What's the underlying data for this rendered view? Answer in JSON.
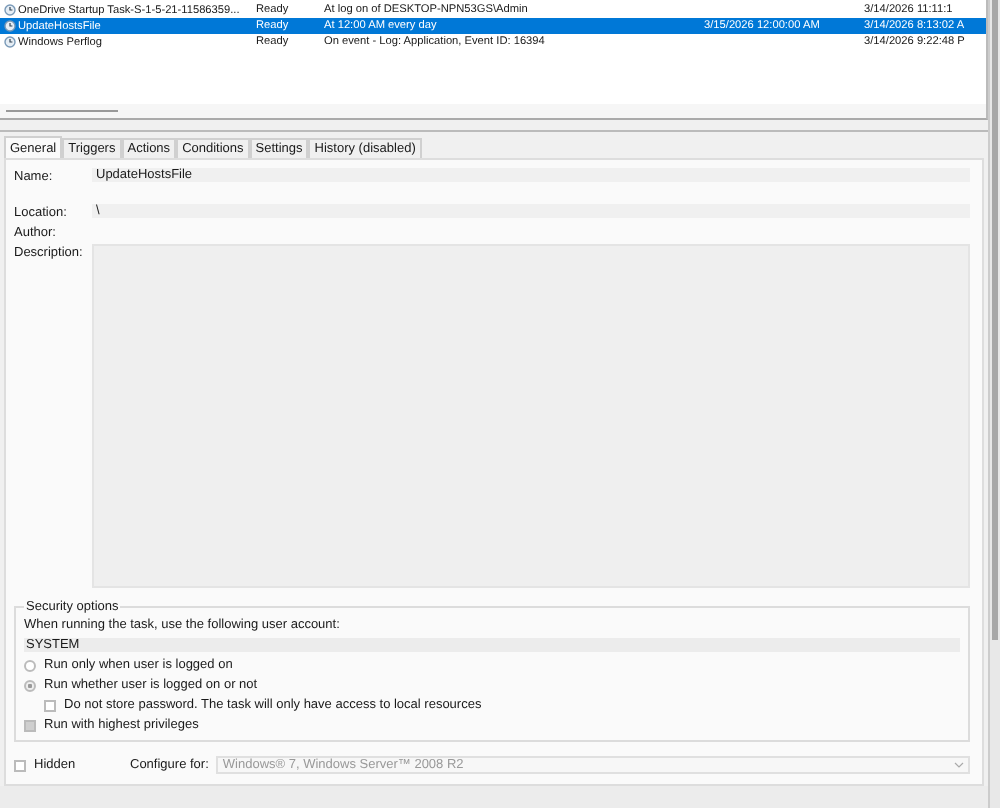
{
  "tasks": [
    {
      "name": "OneDrive Startup Task-S-1-5-21-11586359...",
      "status": "Ready",
      "triggers": "At log on of DESKTOP-NPN53GS\\Admin",
      "last_run": "3/14/2026 11:11:1",
      "selected": false
    },
    {
      "name": "UpdateHostsFile",
      "status": "Ready",
      "triggers": "At 12:00 AM every day",
      "next_run": "3/15/2026 12:00:00 AM",
      "last_run": "3/14/2026 8:13:02 A",
      "selected": true
    },
    {
      "name": "Windows Perflog",
      "status": "Ready",
      "triggers": "On event - Log: Application, Event ID: 16394",
      "last_run": "3/14/2026 9:22:48 P",
      "selected": false
    }
  ],
  "tabs": [
    {
      "label": "General",
      "selected": true
    },
    {
      "label": "Triggers",
      "selected": false
    },
    {
      "label": "Actions",
      "selected": false
    },
    {
      "label": "Conditions",
      "selected": false
    },
    {
      "label": "Settings",
      "selected": false
    },
    {
      "label": "History (disabled)",
      "selected": false
    }
  ],
  "general": {
    "name_label": "Name:",
    "name": "UpdateHostsFile",
    "location_label": "Location:",
    "location": "\\",
    "author_label": "Author:",
    "description_label": "Description:"
  },
  "security": {
    "title": "Security options",
    "account_label": "When running the task, use the following user account:",
    "account": "SYSTEM",
    "options": [
      {
        "kind": "radio",
        "label": "Run only when user is logged on",
        "selected": false
      },
      {
        "kind": "radio",
        "label": "Run whether user is logged on or not",
        "selected": true
      },
      {
        "kind": "subcheck",
        "label": "Do not store password.  The task will only have access to local resources",
        "checked": false
      },
      {
        "kind": "check",
        "label": "Run with highest privileges",
        "checked": true
      }
    ]
  },
  "hidden": {
    "label": "Hidden",
    "checked": false
  },
  "configure": {
    "label": "Configure for:",
    "value": "Windows® 7, Windows Server™ 2008 R2"
  }
}
